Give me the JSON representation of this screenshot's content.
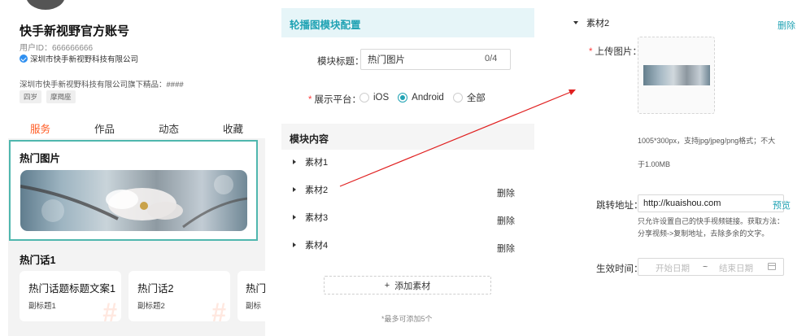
{
  "profile": {
    "account_name": "快手新视野官方账号",
    "user_id": "用户ID：666666666",
    "company": "深圳市快手新视野科技有限公司",
    "description": "深圳市快手新视野科技有限公司旗下精品：####",
    "tags": [
      "四岁",
      "摩羯座"
    ],
    "tabs": [
      "服务",
      "作品",
      "动态",
      "收藏"
    ],
    "active_tab": "服务"
  },
  "hot_pictures": {
    "title": "热门图片"
  },
  "topics": {
    "title": "热门话1",
    "cards": [
      {
        "title": "热门话题标题文案1",
        "subtitle": "副标题1"
      },
      {
        "title": "热门话2",
        "subtitle": "副标题2"
      },
      {
        "title": "热门",
        "subtitle": "副标"
      }
    ]
  },
  "config": {
    "header": "轮播图模块配置",
    "module_title_label": "模块标题：",
    "module_title_value": "热门图片",
    "module_title_count": "0/4",
    "platform_label": "展示平台：",
    "platform_options": [
      "iOS",
      "Android",
      "全部"
    ],
    "platform_selected": "Android",
    "content_header": "模块内容",
    "materials": [
      "素材1",
      "素材2",
      "素材3",
      "素材4"
    ],
    "delete_label": "删除",
    "add_button": "添加素材",
    "max_hint": "*最多可添加5个"
  },
  "detail": {
    "item": "素材2",
    "delete_label": "删除",
    "upload_label": "上传图片：",
    "upload_hint_1": "1005*300px，支持jpg/jpeg/png格式；不大",
    "upload_hint_2": "于1.00MB",
    "url_label": "跳转地址：",
    "url_value": "http://kuaishou.com",
    "preview_label": "预览",
    "url_hint_1": "只允许设置自己的快手视频链接。获取方法：",
    "url_hint_2": "分享视频->复制地址，去除多余的文字。",
    "date_label": "生效时间：",
    "start_placeholder": "开始日期",
    "date_separator": "~",
    "end_placeholder": "结束日期"
  },
  "colors": {
    "accent": "#21a3b4",
    "orange": "#ff5b23",
    "highlight_border": "#4fb7ae",
    "arrow": "#e02020",
    "required": "#ff4040"
  }
}
